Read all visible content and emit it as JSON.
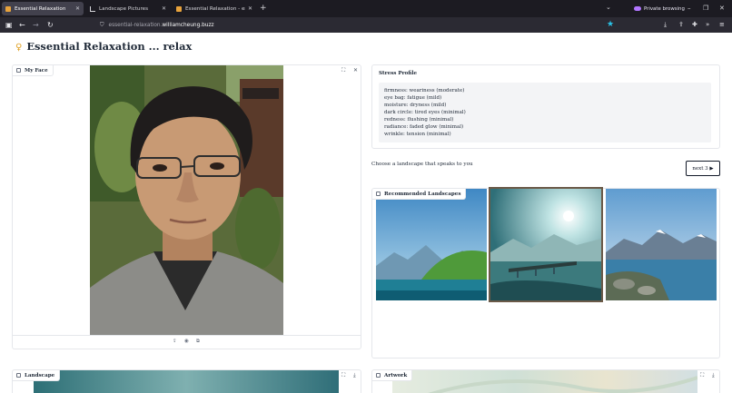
{
  "browser": {
    "tabs": [
      {
        "label": "Essential Relaxation",
        "active": true
      },
      {
        "label": "Landscape Pictures",
        "active": false
      },
      {
        "label": "Essential Relaxation - essential",
        "active": false
      }
    ],
    "tab_close_glyph": "✕",
    "new_tab_glyph": "+",
    "private_label": "Private browsing",
    "url_prefix": "essential-relaxation.",
    "url_host": "williamcheung.buzz"
  },
  "page": {
    "emoji": "🧘",
    "title": "Essential Relaxation ... relax"
  },
  "my_face": {
    "label": "My Face"
  },
  "stress_profile": {
    "title": "Stress Profile",
    "lines": [
      "firmness: weariness (moderate)",
      "eye bag: fatigue (mild)",
      "moisture: dryness (mild)",
      "dark circle: tired eyes (minimal)",
      "redness: flushing (minimal)",
      "radiance: faded glow (minimal)",
      "wrinkle: tension (minimal)"
    ]
  },
  "landscape_prompt": "Choose a landscape that speaks to you",
  "next_button": "next 3 ▶",
  "recommended": {
    "label": "Recommended Landscapes",
    "selected_index": 1
  },
  "landscape_panel": {
    "label": "Landscape"
  },
  "artwork_panel": {
    "label": "Artwork"
  },
  "colors": {
    "tabstrip": "#1c1b22",
    "navbar": "#2b2a33",
    "star": "#2ac3e8",
    "private": "#b176ff",
    "selection": "#6b5a48"
  },
  "icons": [
    "sidebar-icon",
    "back-icon",
    "forward-icon",
    "reload-icon",
    "shield-icon",
    "bookmark-star-icon",
    "download-icon",
    "extensions-icon",
    "menu-icon",
    "fullscreen-icon",
    "close-icon",
    "share-icon",
    "download-icon"
  ]
}
